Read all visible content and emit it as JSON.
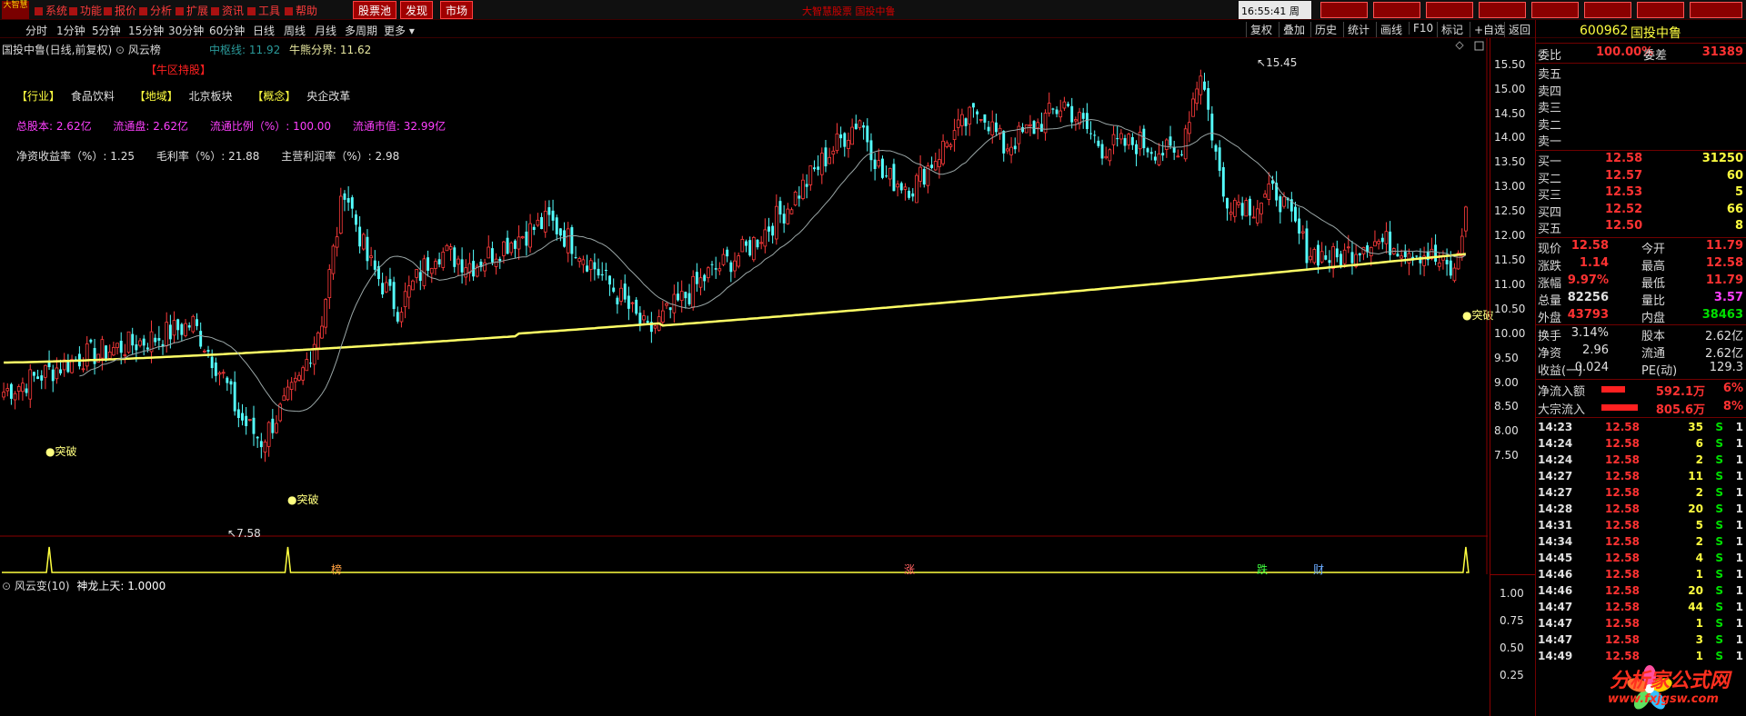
{
  "menu": {
    "logo": "大智慧",
    "items": [
      "系统",
      "功能",
      "报价",
      "分析",
      "扩展",
      "资讯",
      "工具",
      "帮助"
    ],
    "buttons": [
      "股票池",
      "发现",
      "市场"
    ],
    "marquee": "大智慧股票 国投中鲁",
    "time": "16:55:41",
    "weekday": "周五"
  },
  "period_tabs": [
    "分时",
    "1分钟",
    "5分钟",
    "15分钟",
    "30分钟",
    "60分钟",
    "日线",
    "周线",
    "月线",
    "多周期",
    "更多"
  ],
  "tool_tabs": [
    "复权",
    "叠加",
    "历史",
    "统计",
    "画线",
    "F10",
    "标记",
    "+自选",
    "返回"
  ],
  "chart": {
    "title": "国投中鲁(日线,前复权)",
    "indicator_name": "风云榜",
    "mid_line_label": "中枢线: 11.92",
    "bull_bear_label": "牛熊分界: 11.62",
    "tag_red": "【牛区持股】",
    "row1": [
      {
        "k": "【行业】",
        "v": "食品饮料"
      },
      {
        "k": "【地域】",
        "v": "北京板块"
      },
      {
        "k": "【概念】",
        "v": "央企改革"
      }
    ],
    "row2": [
      "总股本: 2.62亿",
      "流通盘: 2.62亿",
      "流通比例（%）: 100.00",
      "流通市值: 32.99亿"
    ],
    "row3": [
      "净资收益率（%）: 1.25",
      "毛利率（%）: 21.88",
      "主营利润率（%）: 2.98"
    ],
    "high_label": "15.45",
    "low_label": "7.58",
    "signal_label": "●突破",
    "signal_label_right": "●突破",
    "event_marks": [
      "榜",
      "涨",
      "跌",
      "财"
    ],
    "y_ticks": [
      "15.50",
      "15.00",
      "14.50",
      "14.00",
      "13.50",
      "13.00",
      "12.50",
      "12.00",
      "11.50",
      "11.00",
      "10.50",
      "10.00",
      "9.50",
      "9.00",
      "8.50",
      "8.00",
      "7.50"
    ],
    "colors": {
      "up": "#ff3b3b",
      "down": "#54ffff",
      "ma_long": "#ffff66",
      "ma_mid": "#9aa6a6",
      "grid": "#5a0000"
    }
  },
  "chart_data": {
    "type": "candlestick",
    "title": "国投中鲁(日线,前复权)",
    "y_range": [
      7.3,
      15.7
    ],
    "high": 15.45,
    "low": 7.58,
    "last_close": 12.58,
    "key_points": [
      {
        "i": 0,
        "close": 8.8
      },
      {
        "i": 20,
        "close": 9.5
      },
      {
        "i": 40,
        "close": 9.9
      },
      {
        "i": 50,
        "close": 10.2
      },
      {
        "i": 58,
        "close": 9.1
      },
      {
        "i": 62,
        "close": 8.3
      },
      {
        "i": 68,
        "close": 7.8
      },
      {
        "i": 78,
        "close": 9.0
      },
      {
        "i": 84,
        "close": 10.3
      },
      {
        "i": 90,
        "close": 13.0
      },
      {
        "i": 96,
        "close": 11.5
      },
      {
        "i": 104,
        "close": 10.5
      },
      {
        "i": 114,
        "close": 11.7
      },
      {
        "i": 124,
        "close": 11.4
      },
      {
        "i": 134,
        "close": 11.9
      },
      {
        "i": 144,
        "close": 12.3
      },
      {
        "i": 152,
        "close": 11.7
      },
      {
        "i": 162,
        "close": 10.8
      },
      {
        "i": 170,
        "close": 10.0
      },
      {
        "i": 178,
        "close": 10.6
      },
      {
        "i": 186,
        "close": 11.2
      },
      {
        "i": 196,
        "close": 11.7
      },
      {
        "i": 206,
        "close": 12.5
      },
      {
        "i": 216,
        "close": 13.5
      },
      {
        "i": 226,
        "close": 14.4
      },
      {
        "i": 232,
        "close": 13.2
      },
      {
        "i": 240,
        "close": 13.0
      },
      {
        "i": 250,
        "close": 14.0
      },
      {
        "i": 258,
        "close": 14.6
      },
      {
        "i": 264,
        "close": 13.8
      },
      {
        "i": 272,
        "close": 14.2
      },
      {
        "i": 280,
        "close": 14.7
      },
      {
        "i": 290,
        "close": 13.8
      },
      {
        "i": 300,
        "close": 13.9
      },
      {
        "i": 310,
        "close": 13.6
      },
      {
        "i": 316,
        "close": 15.4
      },
      {
        "i": 322,
        "close": 12.8
      },
      {
        "i": 330,
        "close": 12.6
      },
      {
        "i": 336,
        "close": 12.9
      },
      {
        "i": 344,
        "close": 11.7
      },
      {
        "i": 352,
        "close": 11.5
      },
      {
        "i": 360,
        "close": 11.9
      },
      {
        "i": 368,
        "close": 11.8
      },
      {
        "i": 376,
        "close": 11.6
      },
      {
        "i": 383,
        "close": 11.2
      },
      {
        "i": 386,
        "close": 12.58
      }
    ],
    "series": [
      {
        "name": "牛熊分界",
        "values_start": 9.4,
        "values_end": 11.62
      },
      {
        "name": "中枢线",
        "value": 11.92
      }
    ],
    "indicator": {
      "title": "风云变(10)",
      "line_name": "神龙上天",
      "value": "1.0000",
      "y_ticks": [
        "1.00",
        "0.75",
        "0.50",
        "0.25"
      ],
      "spikes_at": [
        12,
        75,
        386
      ]
    }
  },
  "quote": {
    "code": "600962",
    "name": "国投中鲁",
    "weibi_label": "委比",
    "weibi": "100.00%",
    "weicha_label": "委差",
    "weicha": "31389",
    "sells": [
      {
        "label": "卖五",
        "price": "",
        "vol": ""
      },
      {
        "label": "卖四",
        "price": "",
        "vol": ""
      },
      {
        "label": "卖三",
        "price": "",
        "vol": ""
      },
      {
        "label": "卖二",
        "price": "",
        "vol": ""
      },
      {
        "label": "卖一",
        "price": "",
        "vol": ""
      }
    ],
    "buys": [
      {
        "label": "买一",
        "price": "12.58",
        "vol": "31250"
      },
      {
        "label": "买二",
        "price": "12.57",
        "vol": "60"
      },
      {
        "label": "买三",
        "price": "12.53",
        "vol": "5"
      },
      {
        "label": "买四",
        "price": "12.52",
        "vol": "66"
      },
      {
        "label": "买五",
        "price": "12.50",
        "vol": "8"
      }
    ],
    "stats": [
      {
        "l1": "现价",
        "v1": "12.58",
        "c1": "red",
        "l2": "今开",
        "v2": "11.79",
        "c2": "red"
      },
      {
        "l1": "涨跌",
        "v1": "1.14",
        "c1": "red",
        "l2": "最高",
        "v2": "12.58",
        "c2": "red"
      },
      {
        "l1": "涨幅",
        "v1": "9.97%",
        "c1": "red",
        "l2": "最低",
        "v2": "11.79",
        "c2": "red"
      },
      {
        "l1": "总量",
        "v1": "82256",
        "c1": "white",
        "l2": "量比",
        "v2": "3.57",
        "c2": "purple"
      },
      {
        "l1": "外盘",
        "v1": "43793",
        "c1": "red",
        "l2": "内盘",
        "v2": "38463",
        "c2": "green"
      }
    ],
    "stats2": [
      {
        "l1": "换手",
        "v1": "3.14%",
        "l2": "股本",
        "v2": "2.62亿"
      },
      {
        "l1": "净资",
        "v1": "2.96",
        "l2": "流通",
        "v2": "2.62亿"
      },
      {
        "l1": "收益(一)",
        "v1": "0.024",
        "l2": "PE(动)",
        "v2": "129.3"
      }
    ],
    "flows": [
      {
        "label": "净流入额",
        "value": "592.1万",
        "pct": "6%",
        "bar": 0.6
      },
      {
        "label": "大宗流入",
        "value": "805.6万",
        "pct": "8%",
        "bar": 0.9
      }
    ],
    "ticks": [
      {
        "t": "14:23",
        "p": "12.58",
        "v": "35",
        "s": "S",
        "n": "1"
      },
      {
        "t": "14:24",
        "p": "12.58",
        "v": "6",
        "s": "S",
        "n": "1"
      },
      {
        "t": "14:24",
        "p": "12.58",
        "v": "2",
        "s": "S",
        "n": "1"
      },
      {
        "t": "14:27",
        "p": "12.58",
        "v": "11",
        "s": "S",
        "n": "1"
      },
      {
        "t": "14:27",
        "p": "12.58",
        "v": "2",
        "s": "S",
        "n": "1"
      },
      {
        "t": "14:28",
        "p": "12.58",
        "v": "20",
        "s": "S",
        "n": "1"
      },
      {
        "t": "14:31",
        "p": "12.58",
        "v": "5",
        "s": "S",
        "n": "1"
      },
      {
        "t": "14:34",
        "p": "12.58",
        "v": "2",
        "s": "S",
        "n": "1"
      },
      {
        "t": "14:45",
        "p": "12.58",
        "v": "4",
        "s": "S",
        "n": "1"
      },
      {
        "t": "14:46",
        "p": "12.58",
        "v": "1",
        "s": "S",
        "n": "1"
      },
      {
        "t": "14:46",
        "p": "12.58",
        "v": "20",
        "s": "S",
        "n": "1"
      },
      {
        "t": "14:47",
        "p": "12.58",
        "v": "44",
        "s": "S",
        "n": "1"
      },
      {
        "t": "14:47",
        "p": "12.58",
        "v": "1",
        "s": "S",
        "n": "1"
      },
      {
        "t": "14:47",
        "p": "12.58",
        "v": "3",
        "s": "S",
        "n": "1"
      },
      {
        "t": "14:49",
        "p": "12.58",
        "v": "1",
        "s": "S",
        "n": "1"
      }
    ]
  },
  "watermark": {
    "text": "分析家公式网",
    "url": "www.fxjgsw.com"
  }
}
